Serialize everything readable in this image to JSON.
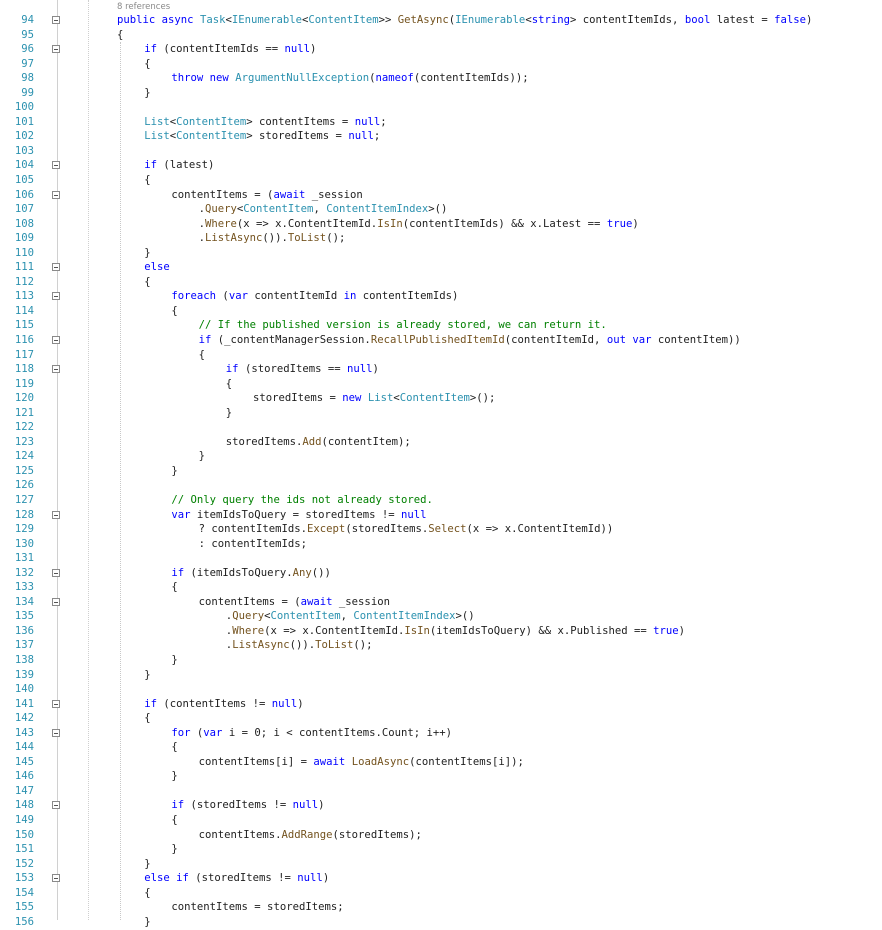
{
  "editor": {
    "codelens": "8 references",
    "first_line_number": 94,
    "lines": [
      {
        "n": "94",
        "fold": true,
        "indent": 0,
        "t": [
          [
            "kw",
            "public"
          ],
          [
            "pl",
            " "
          ],
          [
            "kw",
            "async"
          ],
          [
            "pl",
            " "
          ],
          [
            "ty",
            "Task"
          ],
          [
            "pl",
            "<"
          ],
          [
            "ty",
            "IEnumerable"
          ],
          [
            "pl",
            "<"
          ],
          [
            "ty",
            "ContentItem"
          ],
          [
            "pl",
            ">> "
          ],
          [
            "mt",
            "GetAsync"
          ],
          [
            "pl",
            "("
          ],
          [
            "ty",
            "IEnumerable"
          ],
          [
            "pl",
            "<"
          ],
          [
            "kw",
            "string"
          ],
          [
            "pl",
            "> contentItemIds, "
          ],
          [
            "kw",
            "bool"
          ],
          [
            "pl",
            " latest = "
          ],
          [
            "kw",
            "false"
          ],
          [
            "pl",
            ")"
          ]
        ]
      },
      {
        "n": "95",
        "fold": false,
        "indent": 0,
        "t": [
          [
            "pl",
            "{"
          ]
        ]
      },
      {
        "n": "96",
        "fold": true,
        "indent": 1,
        "t": [
          [
            "kw",
            "if"
          ],
          [
            "pl",
            " (contentItemIds == "
          ],
          [
            "kw",
            "null"
          ],
          [
            "pl",
            ")"
          ]
        ]
      },
      {
        "n": "97",
        "fold": false,
        "indent": 1,
        "t": [
          [
            "pl",
            "{"
          ]
        ]
      },
      {
        "n": "98",
        "fold": false,
        "indent": 2,
        "t": [
          [
            "kw",
            "throw"
          ],
          [
            "pl",
            " "
          ],
          [
            "kw",
            "new"
          ],
          [
            "pl",
            " "
          ],
          [
            "ty",
            "ArgumentNullException"
          ],
          [
            "pl",
            "("
          ],
          [
            "kw",
            "nameof"
          ],
          [
            "pl",
            "(contentItemIds));"
          ]
        ]
      },
      {
        "n": "99",
        "fold": false,
        "indent": 1,
        "t": [
          [
            "pl",
            "}"
          ]
        ]
      },
      {
        "n": "100",
        "fold": false,
        "indent": 0,
        "t": []
      },
      {
        "n": "101",
        "fold": false,
        "indent": 1,
        "t": [
          [
            "ty",
            "List"
          ],
          [
            "pl",
            "<"
          ],
          [
            "ty",
            "ContentItem"
          ],
          [
            "pl",
            "> contentItems = "
          ],
          [
            "kw",
            "null"
          ],
          [
            "pl",
            ";"
          ]
        ]
      },
      {
        "n": "102",
        "fold": false,
        "indent": 1,
        "t": [
          [
            "ty",
            "List"
          ],
          [
            "pl",
            "<"
          ],
          [
            "ty",
            "ContentItem"
          ],
          [
            "pl",
            "> storedItems = "
          ],
          [
            "kw",
            "null"
          ],
          [
            "pl",
            ";"
          ]
        ]
      },
      {
        "n": "103",
        "fold": false,
        "indent": 0,
        "t": []
      },
      {
        "n": "104",
        "fold": true,
        "indent": 1,
        "t": [
          [
            "kw",
            "if"
          ],
          [
            "pl",
            " (latest)"
          ]
        ]
      },
      {
        "n": "105",
        "fold": false,
        "indent": 1,
        "t": [
          [
            "pl",
            "{"
          ]
        ]
      },
      {
        "n": "106",
        "fold": true,
        "indent": 2,
        "t": [
          [
            "pl",
            "contentItems = ("
          ],
          [
            "kw",
            "await"
          ],
          [
            "pl",
            " _session"
          ]
        ]
      },
      {
        "n": "107",
        "fold": false,
        "indent": 3,
        "t": [
          [
            "pl",
            "."
          ],
          [
            "mt",
            "Query"
          ],
          [
            "pl",
            "<"
          ],
          [
            "ty",
            "ContentItem"
          ],
          [
            "pl",
            ", "
          ],
          [
            "ty",
            "ContentItemIndex"
          ],
          [
            "pl",
            ">()"
          ]
        ]
      },
      {
        "n": "108",
        "fold": false,
        "indent": 3,
        "t": [
          [
            "pl",
            "."
          ],
          [
            "mt",
            "Where"
          ],
          [
            "pl",
            "(x => x.ContentItemId."
          ],
          [
            "mt",
            "IsIn"
          ],
          [
            "pl",
            "(contentItemIds) && x.Latest == "
          ],
          [
            "kw",
            "true"
          ],
          [
            "pl",
            ")"
          ]
        ]
      },
      {
        "n": "109",
        "fold": false,
        "indent": 3,
        "t": [
          [
            "pl",
            "."
          ],
          [
            "mt",
            "ListAsync"
          ],
          [
            "pl",
            "())."
          ],
          [
            "mt",
            "ToList"
          ],
          [
            "pl",
            "();"
          ]
        ]
      },
      {
        "n": "110",
        "fold": false,
        "indent": 1,
        "t": [
          [
            "pl",
            "}"
          ]
        ]
      },
      {
        "n": "111",
        "fold": true,
        "indent": 1,
        "t": [
          [
            "kw",
            "else"
          ]
        ]
      },
      {
        "n": "112",
        "fold": false,
        "indent": 1,
        "t": [
          [
            "pl",
            "{"
          ]
        ]
      },
      {
        "n": "113",
        "fold": true,
        "indent": 2,
        "t": [
          [
            "kw",
            "foreach"
          ],
          [
            "pl",
            " ("
          ],
          [
            "kw",
            "var"
          ],
          [
            "pl",
            " contentItemId "
          ],
          [
            "kw",
            "in"
          ],
          [
            "pl",
            " contentItemIds)"
          ]
        ]
      },
      {
        "n": "114",
        "fold": false,
        "indent": 2,
        "t": [
          [
            "pl",
            "{"
          ]
        ]
      },
      {
        "n": "115",
        "fold": false,
        "indent": 3,
        "t": [
          [
            "cm",
            "// If the published version is already stored, we can return it."
          ]
        ]
      },
      {
        "n": "116",
        "fold": true,
        "indent": 3,
        "t": [
          [
            "kw",
            "if"
          ],
          [
            "pl",
            " (_contentManagerSession."
          ],
          [
            "mt",
            "RecallPublishedItemId"
          ],
          [
            "pl",
            "(contentItemId, "
          ],
          [
            "kw",
            "out"
          ],
          [
            "pl",
            " "
          ],
          [
            "kw",
            "var"
          ],
          [
            "pl",
            " contentItem))"
          ]
        ]
      },
      {
        "n": "117",
        "fold": false,
        "indent": 3,
        "t": [
          [
            "pl",
            "{"
          ]
        ]
      },
      {
        "n": "118",
        "fold": true,
        "indent": 4,
        "t": [
          [
            "kw",
            "if"
          ],
          [
            "pl",
            " (storedItems == "
          ],
          [
            "kw",
            "null"
          ],
          [
            "pl",
            ")"
          ]
        ]
      },
      {
        "n": "119",
        "fold": false,
        "indent": 4,
        "t": [
          [
            "pl",
            "{"
          ]
        ]
      },
      {
        "n": "120",
        "fold": false,
        "indent": 5,
        "t": [
          [
            "pl",
            "storedItems = "
          ],
          [
            "kw",
            "new"
          ],
          [
            "pl",
            " "
          ],
          [
            "ty",
            "List"
          ],
          [
            "pl",
            "<"
          ],
          [
            "ty",
            "ContentItem"
          ],
          [
            "pl",
            ">();"
          ]
        ]
      },
      {
        "n": "121",
        "fold": false,
        "indent": 4,
        "t": [
          [
            "pl",
            "}"
          ]
        ]
      },
      {
        "n": "122",
        "fold": false,
        "indent": 0,
        "t": []
      },
      {
        "n": "123",
        "fold": false,
        "indent": 4,
        "t": [
          [
            "pl",
            "storedItems."
          ],
          [
            "mt",
            "Add"
          ],
          [
            "pl",
            "(contentItem);"
          ]
        ]
      },
      {
        "n": "124",
        "fold": false,
        "indent": 3,
        "t": [
          [
            "pl",
            "}"
          ]
        ]
      },
      {
        "n": "125",
        "fold": false,
        "indent": 2,
        "t": [
          [
            "pl",
            "}"
          ]
        ]
      },
      {
        "n": "126",
        "fold": false,
        "indent": 0,
        "t": []
      },
      {
        "n": "127",
        "fold": false,
        "indent": 2,
        "t": [
          [
            "cm",
            "// Only query the ids not already stored."
          ]
        ]
      },
      {
        "n": "128",
        "fold": true,
        "indent": 2,
        "t": [
          [
            "kw",
            "var"
          ],
          [
            "pl",
            " itemIdsToQuery = storedItems != "
          ],
          [
            "kw",
            "null"
          ]
        ]
      },
      {
        "n": "129",
        "fold": false,
        "indent": 3,
        "t": [
          [
            "pl",
            "? contentItemIds."
          ],
          [
            "mt",
            "Except"
          ],
          [
            "pl",
            "(storedItems."
          ],
          [
            "mt",
            "Select"
          ],
          [
            "pl",
            "(x => x.ContentItemId))"
          ]
        ]
      },
      {
        "n": "130",
        "fold": false,
        "indent": 3,
        "t": [
          [
            "pl",
            ": contentItemIds;"
          ]
        ]
      },
      {
        "n": "131",
        "fold": false,
        "indent": 0,
        "t": []
      },
      {
        "n": "132",
        "fold": true,
        "indent": 2,
        "t": [
          [
            "kw",
            "if"
          ],
          [
            "pl",
            " (itemIdsToQuery."
          ],
          [
            "mt",
            "Any"
          ],
          [
            "pl",
            "())"
          ]
        ]
      },
      {
        "n": "133",
        "fold": false,
        "indent": 2,
        "t": [
          [
            "pl",
            "{"
          ]
        ]
      },
      {
        "n": "134",
        "fold": true,
        "indent": 3,
        "t": [
          [
            "pl",
            "contentItems = ("
          ],
          [
            "kw",
            "await"
          ],
          [
            "pl",
            " _session"
          ]
        ]
      },
      {
        "n": "135",
        "fold": false,
        "indent": 4,
        "t": [
          [
            "pl",
            "."
          ],
          [
            "mt",
            "Query"
          ],
          [
            "pl",
            "<"
          ],
          [
            "ty",
            "ContentItem"
          ],
          [
            "pl",
            ", "
          ],
          [
            "ty",
            "ContentItemIndex"
          ],
          [
            "pl",
            ">()"
          ]
        ]
      },
      {
        "n": "136",
        "fold": false,
        "indent": 4,
        "t": [
          [
            "pl",
            "."
          ],
          [
            "mt",
            "Where"
          ],
          [
            "pl",
            "(x => x.ContentItemId."
          ],
          [
            "mt",
            "IsIn"
          ],
          [
            "pl",
            "(itemIdsToQuery) && x.Published == "
          ],
          [
            "kw",
            "true"
          ],
          [
            "pl",
            ")"
          ]
        ]
      },
      {
        "n": "137",
        "fold": false,
        "indent": 4,
        "t": [
          [
            "pl",
            "."
          ],
          [
            "mt",
            "ListAsync"
          ],
          [
            "pl",
            "())."
          ],
          [
            "mt",
            "ToList"
          ],
          [
            "pl",
            "();"
          ]
        ]
      },
      {
        "n": "138",
        "fold": false,
        "indent": 2,
        "t": [
          [
            "pl",
            "}"
          ]
        ]
      },
      {
        "n": "139",
        "fold": false,
        "indent": 1,
        "t": [
          [
            "pl",
            "}"
          ]
        ]
      },
      {
        "n": "140",
        "fold": false,
        "indent": 0,
        "t": []
      },
      {
        "n": "141",
        "fold": true,
        "indent": 1,
        "t": [
          [
            "kw",
            "if"
          ],
          [
            "pl",
            " (contentItems != "
          ],
          [
            "kw",
            "null"
          ],
          [
            "pl",
            ")"
          ]
        ]
      },
      {
        "n": "142",
        "fold": false,
        "indent": 1,
        "t": [
          [
            "pl",
            "{"
          ]
        ]
      },
      {
        "n": "143",
        "fold": true,
        "indent": 2,
        "t": [
          [
            "kw",
            "for"
          ],
          [
            "pl",
            " ("
          ],
          [
            "kw",
            "var"
          ],
          [
            "pl",
            " i = 0; i < contentItems.Count; i++)"
          ]
        ]
      },
      {
        "n": "144",
        "fold": false,
        "indent": 2,
        "t": [
          [
            "pl",
            "{"
          ]
        ]
      },
      {
        "n": "145",
        "fold": false,
        "indent": 3,
        "t": [
          [
            "pl",
            "contentItems[i] = "
          ],
          [
            "kw",
            "await"
          ],
          [
            "pl",
            " "
          ],
          [
            "mt",
            "LoadAsync"
          ],
          [
            "pl",
            "(contentItems[i]);"
          ]
        ]
      },
      {
        "n": "146",
        "fold": false,
        "indent": 2,
        "t": [
          [
            "pl",
            "}"
          ]
        ]
      },
      {
        "n": "147",
        "fold": false,
        "indent": 0,
        "t": []
      },
      {
        "n": "148",
        "fold": true,
        "indent": 2,
        "t": [
          [
            "kw",
            "if"
          ],
          [
            "pl",
            " (storedItems != "
          ],
          [
            "kw",
            "null"
          ],
          [
            "pl",
            ")"
          ]
        ]
      },
      {
        "n": "149",
        "fold": false,
        "indent": 2,
        "t": [
          [
            "pl",
            "{"
          ]
        ]
      },
      {
        "n": "150",
        "fold": false,
        "indent": 3,
        "t": [
          [
            "pl",
            "contentItems."
          ],
          [
            "mt",
            "AddRange"
          ],
          [
            "pl",
            "(storedItems);"
          ]
        ]
      },
      {
        "n": "151",
        "fold": false,
        "indent": 2,
        "t": [
          [
            "pl",
            "}"
          ]
        ]
      },
      {
        "n": "152",
        "fold": false,
        "indent": 1,
        "t": [
          [
            "pl",
            "}"
          ]
        ]
      },
      {
        "n": "153",
        "fold": true,
        "indent": 1,
        "t": [
          [
            "kw",
            "else"
          ],
          [
            "pl",
            " "
          ],
          [
            "kw",
            "if"
          ],
          [
            "pl",
            " (storedItems != "
          ],
          [
            "kw",
            "null"
          ],
          [
            "pl",
            ")"
          ]
        ]
      },
      {
        "n": "154",
        "fold": false,
        "indent": 1,
        "t": [
          [
            "pl",
            "{"
          ]
        ]
      },
      {
        "n": "155",
        "fold": false,
        "indent": 2,
        "t": [
          [
            "pl",
            "contentItems = storedItems;"
          ]
        ]
      },
      {
        "n": "156",
        "fold": false,
        "indent": 1,
        "t": [
          [
            "pl",
            "}"
          ]
        ]
      }
    ]
  },
  "colors": {
    "keyword": "#0000ff",
    "type": "#2b91af",
    "method": "#74531f",
    "comment": "#008000",
    "line_number": "#2b91af",
    "text": "#1e1e1e"
  },
  "icons": {
    "fold": "collapse-minus-box-icon"
  }
}
